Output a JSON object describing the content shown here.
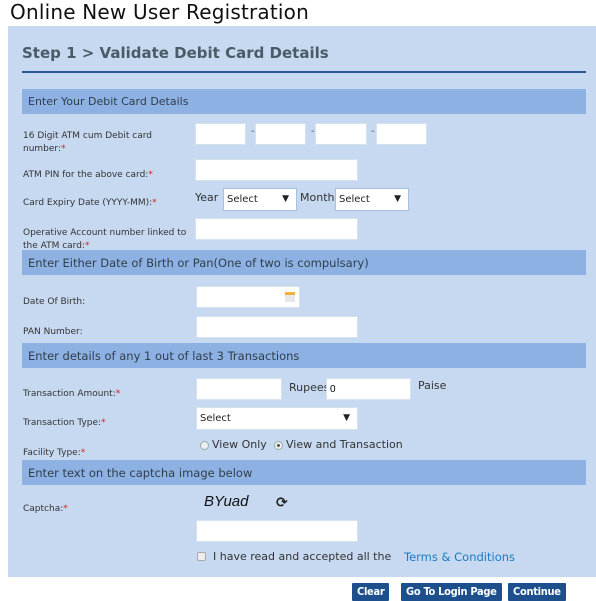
{
  "page_title": "Online New User Registration",
  "step_title": "Step 1 > Validate Debit Card Details",
  "sections": {
    "card": "Enter Your Debit Card Details",
    "dob_pan": "Enter Either Date of Birth or Pan(One of two is compulsary)",
    "transactions": "Enter details of any 1 out of last 3 Transactions",
    "captcha": "Enter text on the captcha image below"
  },
  "fields": {
    "card_number": {
      "label_line1": "16 Digit ATM cum Debit card",
      "label_line2": "number:",
      "separator": "-",
      "values": [
        "",
        "",
        "",
        ""
      ]
    },
    "atm_pin": {
      "label": "ATM PIN for the above card:",
      "value": ""
    },
    "expiry": {
      "label": "Card Expiry Date (YYYY-MM):",
      "year_label": "Year",
      "year_value": "Select",
      "month_label": "Month",
      "month_value": "Select"
    },
    "account": {
      "label_line1": "Operative Account number linked to",
      "label_line2": "the ATM card:",
      "value": ""
    },
    "dob": {
      "label": "Date Of Birth:",
      "value": "",
      "icon": "calendar-icon"
    },
    "pan": {
      "label": "PAN Number:",
      "value": ""
    },
    "txn_amount": {
      "label": "Transaction Amount:",
      "rupees_value": "",
      "rupees_label": "Rupees",
      "paise_value": "0",
      "paise_label": "Paise"
    },
    "txn_type": {
      "label": "Transaction Type:",
      "value": "Select"
    },
    "facility": {
      "label": "Facility Type:",
      "options": [
        {
          "label": "View Only",
          "selected": false
        },
        {
          "label": "View and Transaction",
          "selected": true
        }
      ]
    },
    "captcha": {
      "label": "Captcha:",
      "image_text": "BYuad",
      "refresh_icon": "⟳",
      "value": ""
    },
    "terms": {
      "text": "I have read and accepted all the",
      "link": "Terms & Conditions",
      "checked": false
    }
  },
  "required_marker": "*",
  "dropdown_arrow": "▼",
  "buttons": {
    "clear": "Clear",
    "login": "Go To Login Page",
    "continue": "Continue"
  }
}
